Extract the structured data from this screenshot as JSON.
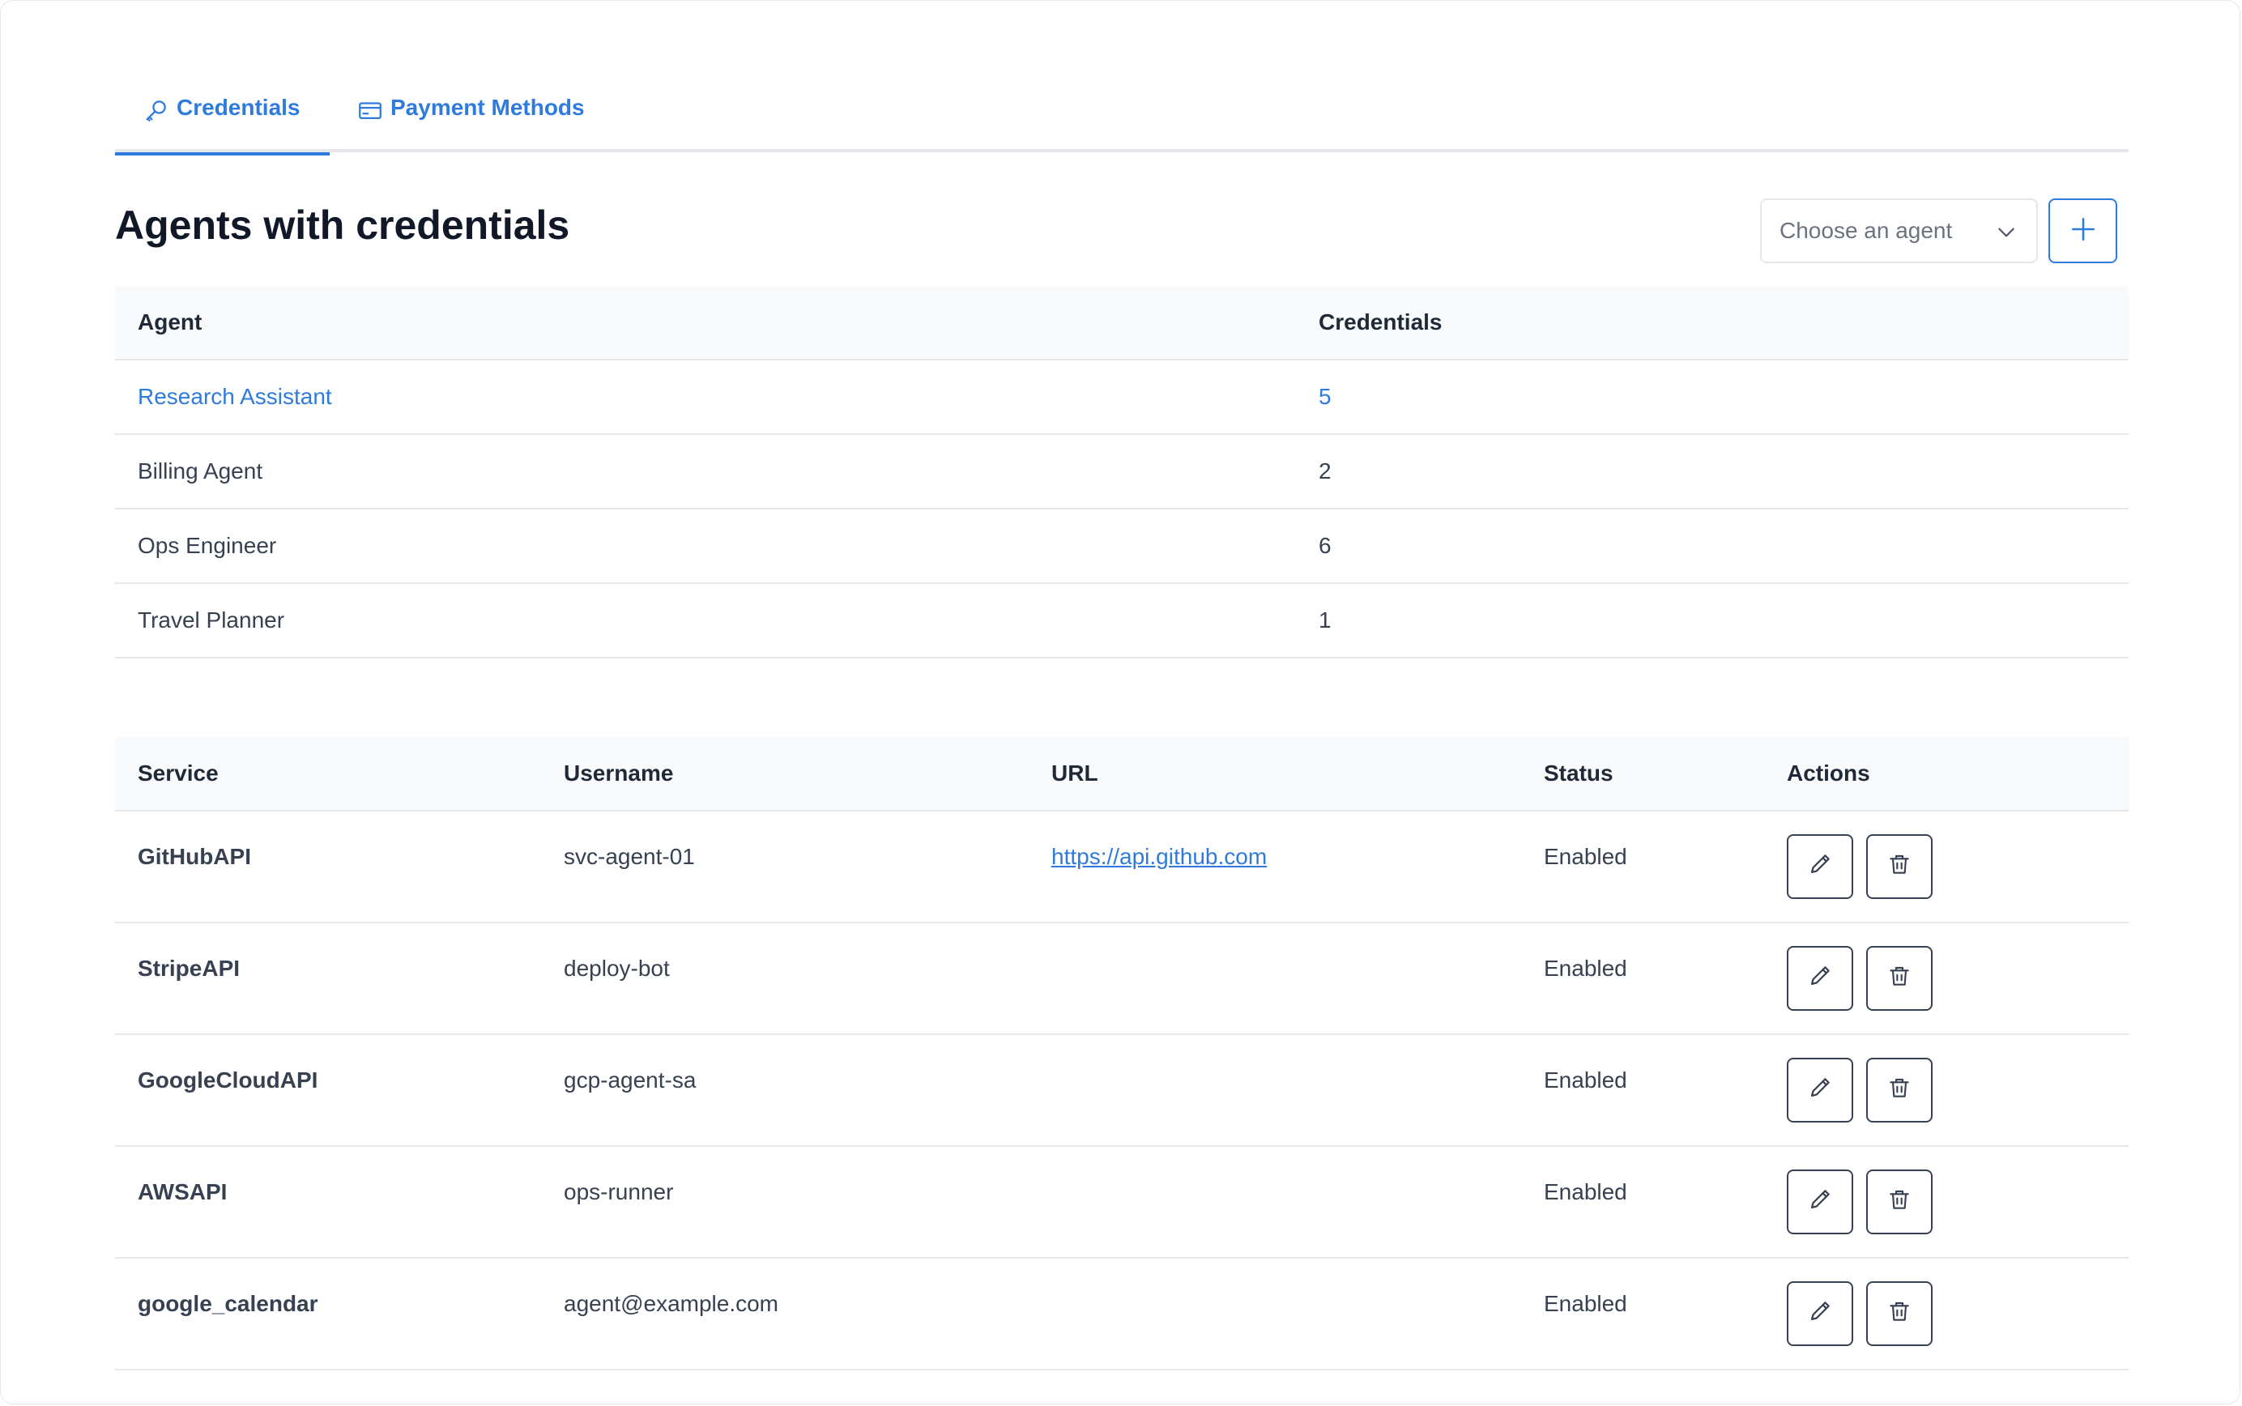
{
  "tabs": [
    {
      "label": "Credentials",
      "icon": "key-icon",
      "active": true
    },
    {
      "label": "Payment Methods",
      "icon": "credit-card-icon",
      "active": false
    }
  ],
  "header": {
    "title": "Agents with credentials",
    "agent_select_placeholder": "Choose an agent"
  },
  "agents_table": {
    "columns": [
      "Agent",
      "Credentials"
    ],
    "rows": [
      {
        "agent": "Research Assistant",
        "credentials": "5",
        "selected": true
      },
      {
        "agent": "Billing Agent",
        "credentials": "2",
        "selected": false
      },
      {
        "agent": "Ops Engineer",
        "credentials": "6",
        "selected": false
      },
      {
        "agent": "Travel Planner",
        "credentials": "1",
        "selected": false
      }
    ]
  },
  "credentials_table": {
    "columns": [
      "Service",
      "Username",
      "URL",
      "Status",
      "Actions"
    ],
    "rows": [
      {
        "service": "GitHubAPI",
        "username": "svc-agent-01",
        "url": "https://api.github.com",
        "status": "Enabled"
      },
      {
        "service": "StripeAPI",
        "username": "deploy-bot",
        "url": "",
        "status": "Enabled"
      },
      {
        "service": "GoogleCloudAPI",
        "username": "gcp-agent-sa",
        "url": "",
        "status": "Enabled"
      },
      {
        "service": "AWSAPI",
        "username": "ops-runner",
        "url": "",
        "status": "Enabled"
      },
      {
        "service": "google_calendar",
        "username": "agent@example.com",
        "url": "",
        "status": "Enabled"
      }
    ]
  },
  "colors": {
    "accent": "#2f7bdc",
    "border": "#e5e7eb",
    "header_bg": "#f9fafb",
    "text": "#374151"
  }
}
